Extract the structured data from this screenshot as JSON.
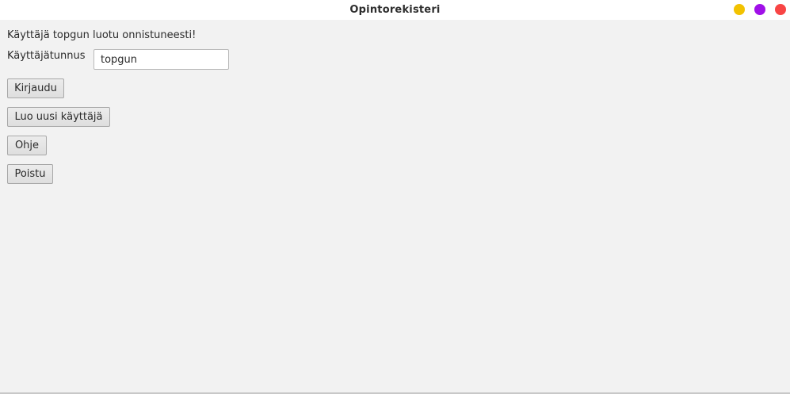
{
  "window": {
    "title": "Opintorekisteri",
    "controls": {
      "minimize_color": "#f2c200",
      "maximize_color": "#a010e8",
      "close_color": "#f84545"
    }
  },
  "main": {
    "status_message": "Käyttäjä topgun luotu onnistuneesti!",
    "username_label": "Käyttäjätunnus",
    "username_value": "topgun",
    "buttons": {
      "login": "Kirjaudu",
      "create_user": "Luo uusi käyttäjä",
      "help": "Ohje",
      "exit": "Poistu"
    }
  }
}
